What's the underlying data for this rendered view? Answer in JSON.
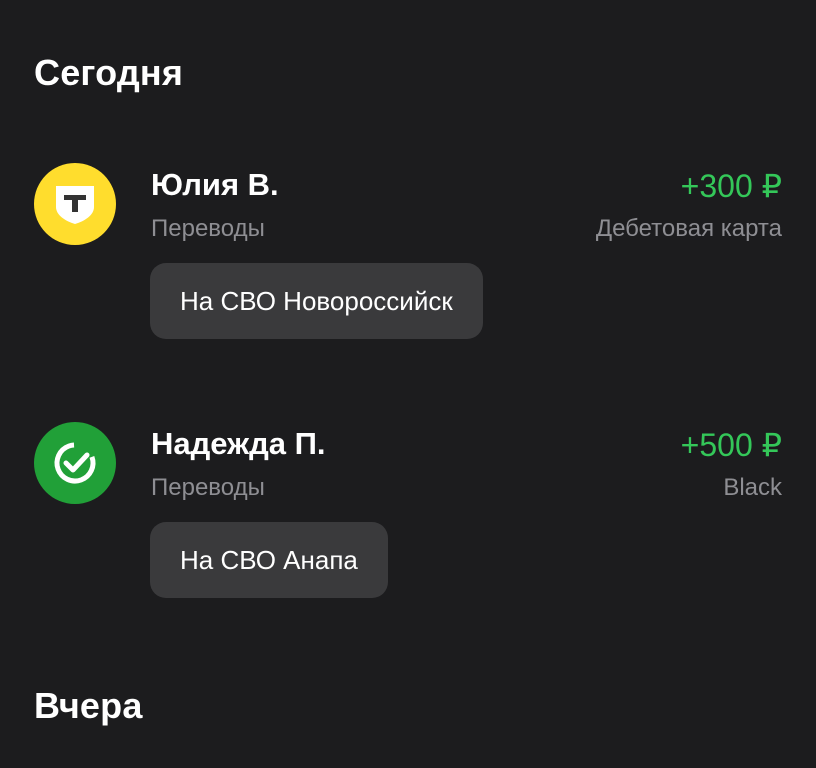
{
  "sections": [
    {
      "title": "Сегодня"
    },
    {
      "title": "Вчера"
    }
  ],
  "operations": [
    {
      "name": "Юлия В.",
      "category": "Переводы",
      "amount": "+300 ₽",
      "account": "Дебетовая карта",
      "comment": "На СВО Новороссийск",
      "bank_icon": "tbank-shield-icon",
      "icon_color": "#ffdd2d"
    },
    {
      "name": "Надежда П.",
      "category": "Переводы",
      "amount": "+500 ₽",
      "account": "Black",
      "comment": "На СВО Анапа",
      "bank_icon": "sber-check-icon",
      "icon_color": "#21a038"
    }
  ],
  "colors": {
    "background": "#1c1c1e",
    "income": "#34c759",
    "secondary_text": "#8e8e93",
    "bubble": "#3a3a3c"
  }
}
